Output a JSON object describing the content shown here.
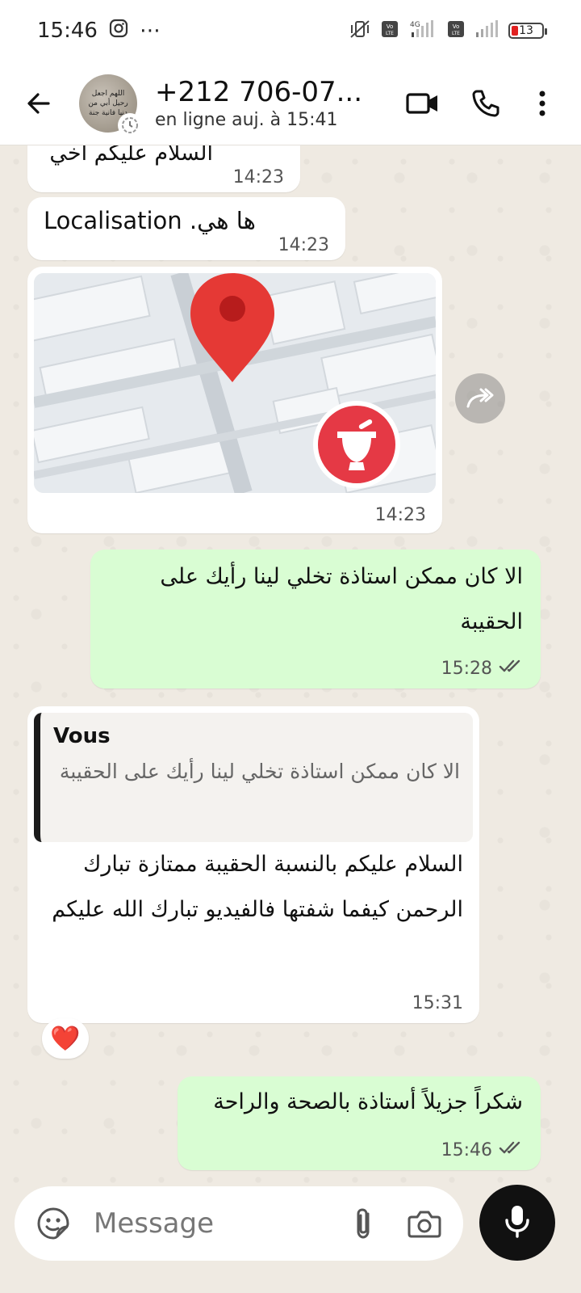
{
  "status_bar": {
    "time": "15:46",
    "battery_level": "13",
    "network": "4G"
  },
  "header": {
    "contact_name": "+212 706-07...",
    "presence": "en ligne auj. à 15:41",
    "avatar_text": "اللهم اجعل رحيل أبي من دنيا فانية جنة"
  },
  "messages": [
    {
      "direction": "in",
      "text": "السلام عليكم أخي",
      "time": "14:23"
    },
    {
      "direction": "in",
      "text": "ها هي. Localisation",
      "time": "14:23"
    },
    {
      "direction": "in",
      "type": "location",
      "time": "14:23"
    },
    {
      "direction": "out",
      "text": "الا كان ممكن استاذة تخلي لينا رأيك على الحقيبة",
      "time": "15:28",
      "read": true
    },
    {
      "direction": "in",
      "quote_author": "Vous",
      "quote_text": "الا كان ممكن استاذة تخلي لينا رأيك على الحقيبة",
      "text": "السلام عليكم بالنسبة الحقيبة ممتازة تبارك الرحمن كيفما شفتها فالفيديو تبارك الله عليكم",
      "time": "15:31",
      "reaction": "❤️"
    },
    {
      "direction": "out",
      "text": "شكراً جزيلاً أستاذة بالصحة والراحة",
      "time": "15:46",
      "read": true
    }
  ],
  "composer": {
    "placeholder": "Message"
  },
  "colors": {
    "outgoing_bubble": "#d9fdd3",
    "incoming_bubble": "#ffffff",
    "chat_background": "#efeae2",
    "read_tick": "#555555"
  }
}
